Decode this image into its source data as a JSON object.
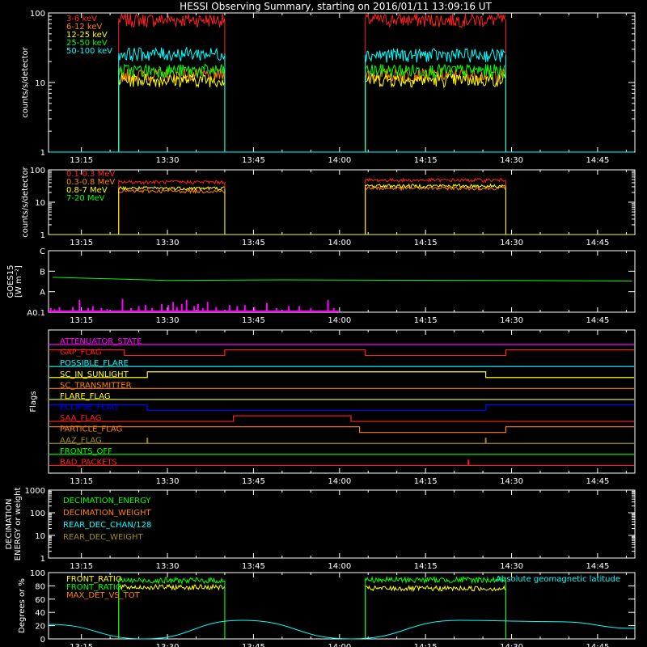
{
  "title": "HESSI Observing Summary, starting on 2016/01/11 13:09:16 UT",
  "time_ticks": [
    "13:15",
    "13:30",
    "13:45",
    "14:00",
    "14:15",
    "14:30",
    "14:45"
  ],
  "colors": {
    "red": "#ff2020",
    "orange": "#ff8000",
    "yellow": "#ffff00",
    "green": "#00ff00",
    "cyan": "#00ffff",
    "magenta": "#ff00ff",
    "blue": "#0000ff",
    "olive": "#a08a10",
    "white": "#ffffff"
  },
  "chart_data": [
    {
      "type": "line",
      "panel": "count-rates-low-energy",
      "ylabel": "counts/s/detector",
      "yscale": "log",
      "ylim": [
        1,
        100
      ],
      "ytick_labels": [
        "1",
        "10",
        "100"
      ],
      "xlim": [
        "13:09:16",
        "14:51:30"
      ],
      "legend_location": "top-left",
      "series": [
        {
          "name": "3-6 keV",
          "color": "red",
          "segments": [
            {
              "start": "13:21:30",
              "end": "13:40:00",
              "value": 80
            },
            {
              "start": "14:04:30",
              "end": "14:29:00",
              "value": 80
            }
          ],
          "baseline": 1
        },
        {
          "name": "6-12 keV",
          "color": "orange",
          "segments": [
            {
              "start": "13:21:30",
              "end": "13:40:00",
              "value": 13
            },
            {
              "start": "14:04:30",
              "end": "14:29:00",
              "value": 13
            }
          ],
          "baseline": 1
        },
        {
          "name": "12-25 keV",
          "color": "yellow",
          "segments": [
            {
              "start": "13:21:30",
              "end": "13:40:00",
              "value": 11
            },
            {
              "start": "14:04:30",
              "end": "14:29:00",
              "value": 11
            }
          ],
          "baseline": 1
        },
        {
          "name": "25-50 keV",
          "color": "green",
          "segments": [
            {
              "start": "13:21:30",
              "end": "13:40:00",
              "value": 15
            },
            {
              "start": "14:04:30",
              "end": "14:29:00",
              "value": 15
            }
          ],
          "baseline": 1
        },
        {
          "name": "50-100 keV",
          "color": "cyan",
          "segments": [
            {
              "start": "13:21:30",
              "end": "13:40:00",
              "value": 26
            },
            {
              "start": "14:04:30",
              "end": "14:29:00",
              "value": 25
            }
          ],
          "baseline": 1
        }
      ]
    },
    {
      "type": "line",
      "panel": "count-rates-high-energy",
      "ylabel": "counts/s/detector",
      "yscale": "log",
      "ylim": [
        1,
        100
      ],
      "ytick_labels": [
        "1",
        "10",
        "100"
      ],
      "legend_location": "top-left",
      "series": [
        {
          "name": "0.1-0.3 MeV",
          "color": "red",
          "segments": [
            {
              "start": "13:21:30",
              "end": "13:40:00",
              "value": 42
            },
            {
              "start": "14:04:30",
              "end": "14:29:00",
              "value": 48
            }
          ],
          "baseline": 1
        },
        {
          "name": "0.3-0.8 MeV",
          "color": "orange",
          "segments": [
            {
              "start": "13:21:30",
              "end": "13:40:00",
              "value": 22
            },
            {
              "start": "14:04:30",
              "end": "14:29:00",
              "value": 27
            }
          ],
          "baseline": 1
        },
        {
          "name": "0.8-7 MeV",
          "color": "yellow",
          "segments": [
            {
              "start": "13:21:30",
              "end": "13:40:00",
              "value": 27
            },
            {
              "start": "14:04:30",
              "end": "14:29:00",
              "value": 32
            }
          ],
          "baseline": 1
        },
        {
          "name": "7-20 MeV",
          "color": "green",
          "segments": [],
          "baseline": 1
        }
      ]
    },
    {
      "type": "line",
      "panel": "goes",
      "ylabel": "GOES15 [W m⁻²]",
      "ytick_labels": [
        "A0.1",
        "A",
        "B",
        "C"
      ],
      "ylim_class": [
        "A0.1",
        "C"
      ],
      "series": [
        {
          "color": "green",
          "values": [
            {
              "t": "13:10",
              "cls": 1.7
            },
            {
              "t": "13:30",
              "cls": 1.55
            },
            {
              "t": "13:50",
              "cls": 1.58
            },
            {
              "t": "14:10",
              "cls": 1.56
            },
            {
              "t": "14:30",
              "cls": 1.55
            },
            {
              "t": "14:51",
              "cls": 1.52
            }
          ]
        }
      ],
      "spikes": [
        {
          "t": "13:09:40",
          "cls": 0.2
        },
        {
          "t": "13:10:20",
          "cls": 0.15
        },
        {
          "t": "13:11:10",
          "cls": 0.25
        },
        {
          "t": "13:13:30",
          "cls": 0.25
        },
        {
          "t": "13:14:40",
          "cls": 0.6
        },
        {
          "t": "13:16:10",
          "cls": 0.2
        },
        {
          "t": "13:17:00",
          "cls": 0.3
        },
        {
          "t": "13:18:30",
          "cls": 0.2
        },
        {
          "t": "13:19:30",
          "cls": 0.15
        },
        {
          "t": "13:22:10",
          "cls": 0.65
        },
        {
          "t": "13:23:40",
          "cls": 0.2
        },
        {
          "t": "13:25:00",
          "cls": 0.3
        },
        {
          "t": "13:26:10",
          "cls": 0.35
        },
        {
          "t": "13:27:20",
          "cls": 0.2
        },
        {
          "t": "13:29:00",
          "cls": 0.4
        },
        {
          "t": "13:30:10",
          "cls": 0.35
        },
        {
          "t": "13:31:00",
          "cls": 0.5
        },
        {
          "t": "13:31:40",
          "cls": 0.25
        },
        {
          "t": "13:32:30",
          "cls": 0.4
        },
        {
          "t": "13:33:20",
          "cls": 0.6
        },
        {
          "t": "13:34:40",
          "cls": 0.3
        },
        {
          "t": "13:35:20",
          "cls": 0.4
        },
        {
          "t": "13:36:10",
          "cls": 0.2
        },
        {
          "t": "13:37:00",
          "cls": 0.5
        },
        {
          "t": "13:38:30",
          "cls": 0.25
        },
        {
          "t": "13:40:50",
          "cls": 0.35
        },
        {
          "t": "13:42:10",
          "cls": 0.3
        },
        {
          "t": "13:43:30",
          "cls": 0.35
        },
        {
          "t": "13:45:10",
          "cls": 0.25
        },
        {
          "t": "13:47:20",
          "cls": 0.45
        },
        {
          "t": "13:49:00",
          "cls": 0.2
        },
        {
          "t": "13:51:10",
          "cls": 0.3
        },
        {
          "t": "13:53:00",
          "cls": 0.3
        },
        {
          "t": "13:55:00",
          "cls": 0.2
        },
        {
          "t": "13:58:00",
          "cls": 0.6
        },
        {
          "t": "13:59:00",
          "cls": 0.2
        }
      ]
    },
    {
      "type": "line",
      "panel": "flags",
      "ylabel": "Flags",
      "series": [
        {
          "name": "ATTENUATOR_STATE",
          "color": "magenta",
          "transitions": []
        },
        {
          "name": "GAP_FLAG",
          "color": "red",
          "transitions": [
            {
              "start": "13:22:30",
              "end": "13:40:00"
            },
            {
              "start": "14:04:30",
              "end": "14:29:00"
            }
          ],
          "state": "low"
        },
        {
          "name": "POSSIBLE_FLARE",
          "color": "cyan",
          "transitions": []
        },
        {
          "name": "SC_IN_SUNLIGHT",
          "color": "yellow",
          "transitions": [
            {
              "start": "13:26:30",
              "end": "14:25:30"
            }
          ],
          "state": "high"
        },
        {
          "name": "SC_TRANSMITTER",
          "color": "orange",
          "transitions": []
        },
        {
          "name": "FLARE_FLAG",
          "color": "yellow",
          "transitions": []
        },
        {
          "name": "ECLIPSE_FLAG",
          "color": "blue",
          "transitions": [
            {
              "start": "13:26:30",
              "end": "14:25:30"
            }
          ],
          "state": "low"
        },
        {
          "name": "SAA_FLAG",
          "color": "red",
          "transitions": [
            {
              "start": "13:41:30",
              "end": "14:02:00"
            }
          ],
          "state": "high"
        },
        {
          "name": "PARTICLE_FLAG",
          "color": "orange",
          "transitions": [
            {
              "start": "14:03:30",
              "end": "14:29:00"
            }
          ],
          "state": "low"
        },
        {
          "name": "AAZ_FLAG",
          "color": "olive",
          "transitions": [],
          "pulses": [
            "13:26:30",
            "14:25:30"
          ]
        },
        {
          "name": "FRONTS_OFF",
          "color": "green",
          "transitions": []
        },
        {
          "name": "BAD_PACKETS",
          "color": "red",
          "transitions": [],
          "pulses": [
            "14:22:30"
          ]
        }
      ]
    },
    {
      "type": "line",
      "panel": "decimation",
      "ylabel": "DECIMATION ENERGY or weight",
      "yscale": "log",
      "ylim": [
        1,
        1000
      ],
      "ytick_labels": [
        "1",
        "10",
        "100",
        "1000"
      ],
      "legend_location": "top-left",
      "series": [
        {
          "name": "DECIMATION_ENERGY",
          "color": "green",
          "values": []
        },
        {
          "name": "DECIMATION_WEIGHT",
          "color": "orange",
          "values": []
        },
        {
          "name": "REAR_DEC_CHAN/128",
          "color": "cyan",
          "values": []
        },
        {
          "name": "REAR_DEC_WEIGHT",
          "color": "olive",
          "values": []
        }
      ]
    },
    {
      "type": "line",
      "panel": "ratios",
      "ylabel": "Degrees or %",
      "ylim": [
        0,
        100
      ],
      "ytick_labels": [
        "0",
        "20",
        "40",
        "60",
        "80",
        "100"
      ],
      "legend_location": "top-left",
      "annotation": "Absolute geomagnetic latitude",
      "series": [
        {
          "name": "FRONT_RATIO",
          "color": "yellow",
          "segments": [
            {
              "start": "13:21:30",
              "end": "13:40:00",
              "value": 78
            },
            {
              "start": "14:04:30",
              "end": "14:29:00",
              "value": 76
            }
          ]
        },
        {
          "name": "FRONT_RATIO_",
          "color": "green",
          "segments": [
            {
              "start": "13:21:30",
              "end": "13:40:00",
              "value": 88
            },
            {
              "start": "14:04:30",
              "end": "14:29:00",
              "value": 89
            }
          ]
        },
        {
          "name": "MAX_DET_VS_TOT",
          "color": "orange",
          "segments": []
        },
        {
          "name": "Absolute geomagnetic latitude",
          "color": "cyan",
          "values": [
            {
              "t": "13:09:16",
              "v": 22
            },
            {
              "t": "13:26:00",
              "v": 0
            },
            {
              "t": "13:43:00",
              "v": 28
            },
            {
              "t": "14:02:00",
              "v": 0
            },
            {
              "t": "14:21:00",
              "v": 28
            },
            {
              "t": "14:38:00",
              "v": 26
            },
            {
              "t": "14:51:30",
              "v": 16
            }
          ]
        }
      ]
    }
  ]
}
